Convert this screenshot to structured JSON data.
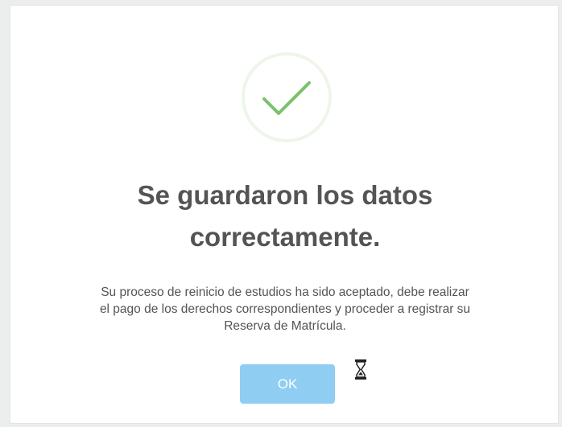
{
  "dialog": {
    "icon": "success-checkmark-icon",
    "title_line1": "Se guardaron los datos",
    "title_line2": "correctamente.",
    "message_line1": "Su proceso de reinicio de estudios ha sido aceptado, debe realizar",
    "message_line2": "el pago de los derechos correspondientes y proceder a registrar su",
    "message_line3": "Reserva de Matrícula.",
    "ok_label": "OK"
  },
  "cursor": {
    "icon": "hourglass-busy-cursor"
  },
  "colors": {
    "check": "#7ac26b",
    "icon_ring": "#eef5ea",
    "title": "#545454",
    "button": "#8fcdf3",
    "button_text": "#ffffff"
  }
}
